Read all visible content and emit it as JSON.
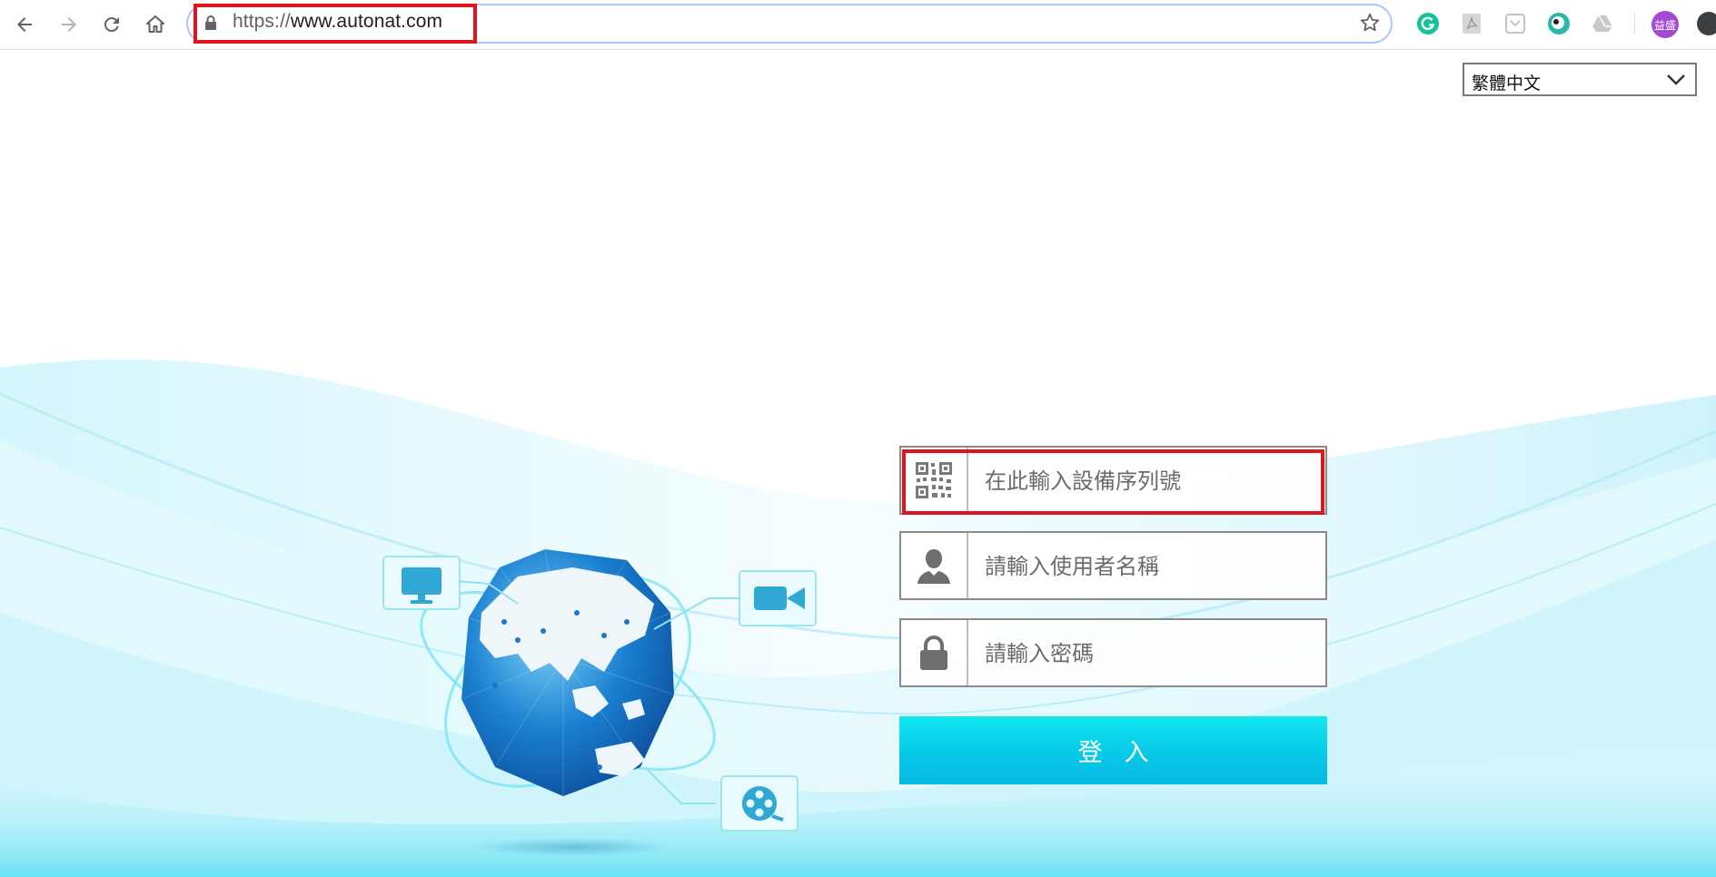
{
  "browser": {
    "url_scheme": "https://",
    "url_host": "www.autonat.com",
    "profile_label": "益盛",
    "extensions": [
      "grammarly-icon",
      "pdf-icon",
      "pocket-icon",
      "puffin-icon",
      "drive-icon"
    ]
  },
  "language": {
    "selected": "繁體中文"
  },
  "login": {
    "serial_placeholder": "在此輸入設備序列號",
    "username_placeholder": "請輸入使用者名稱",
    "password_placeholder": "請輸入密碼",
    "submit_label": "登入"
  },
  "colors": {
    "highlight": "#e0141e",
    "accent_cyan": "#0cd6ec",
    "globe_blue": "#1a7fd0"
  }
}
